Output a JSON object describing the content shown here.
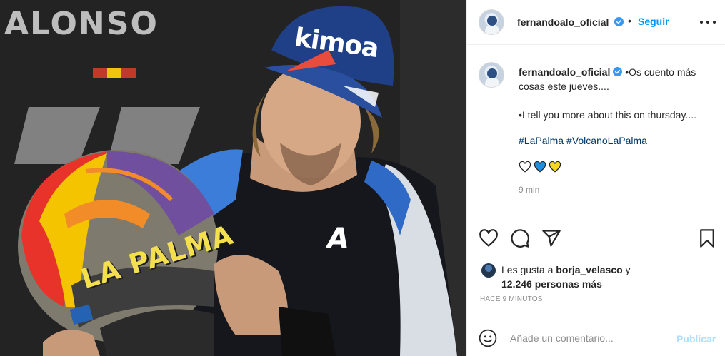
{
  "photo": {
    "alt_marks": {
      "background_brand": "ALONSO",
      "cap_brand": "kimoa",
      "helmet_text": "LA PALMA",
      "suit_logo": "A"
    }
  },
  "header": {
    "username": "fernandoalo_oficial",
    "verified_icon": "verified-badge-icon",
    "separator": "•",
    "follow_label": "Seguir",
    "more_icon": "more-options-icon"
  },
  "caption": {
    "username": "fernandoalo_oficial",
    "text_es": "•Os cuento más cosas este jueves....",
    "text_en": "•I tell you more about this on thursday....",
    "hashtags": [
      "#LaPalma",
      "#VolcanoLaPalma"
    ],
    "hearts": [
      {
        "icon": "white-heart-icon",
        "color": "#ffffff"
      },
      {
        "icon": "blue-heart-icon",
        "color": "#1d8fe1"
      },
      {
        "icon": "yellow-heart-icon",
        "color": "#f7d81c"
      }
    ],
    "time": "9 min"
  },
  "actions": {
    "like_icon": "heart-icon",
    "comment_icon": "comment-icon",
    "share_icon": "send-icon",
    "save_icon": "bookmark-icon"
  },
  "likes": {
    "prefix": "Les gusta a ",
    "user": "borja_velasco",
    "conj": " y",
    "count": "12.246 personas más"
  },
  "posted_ago": "HACE 9 MINUTOS",
  "comment": {
    "emoji_icon": "emoji-icon",
    "placeholder": "Añade un comentario...",
    "publish_label": "Publicar"
  },
  "colors": {
    "accent": "#0095f6",
    "publish_disabled": "#b2dffc",
    "hashtag": "#00376b",
    "muted": "#8e8e8e"
  }
}
